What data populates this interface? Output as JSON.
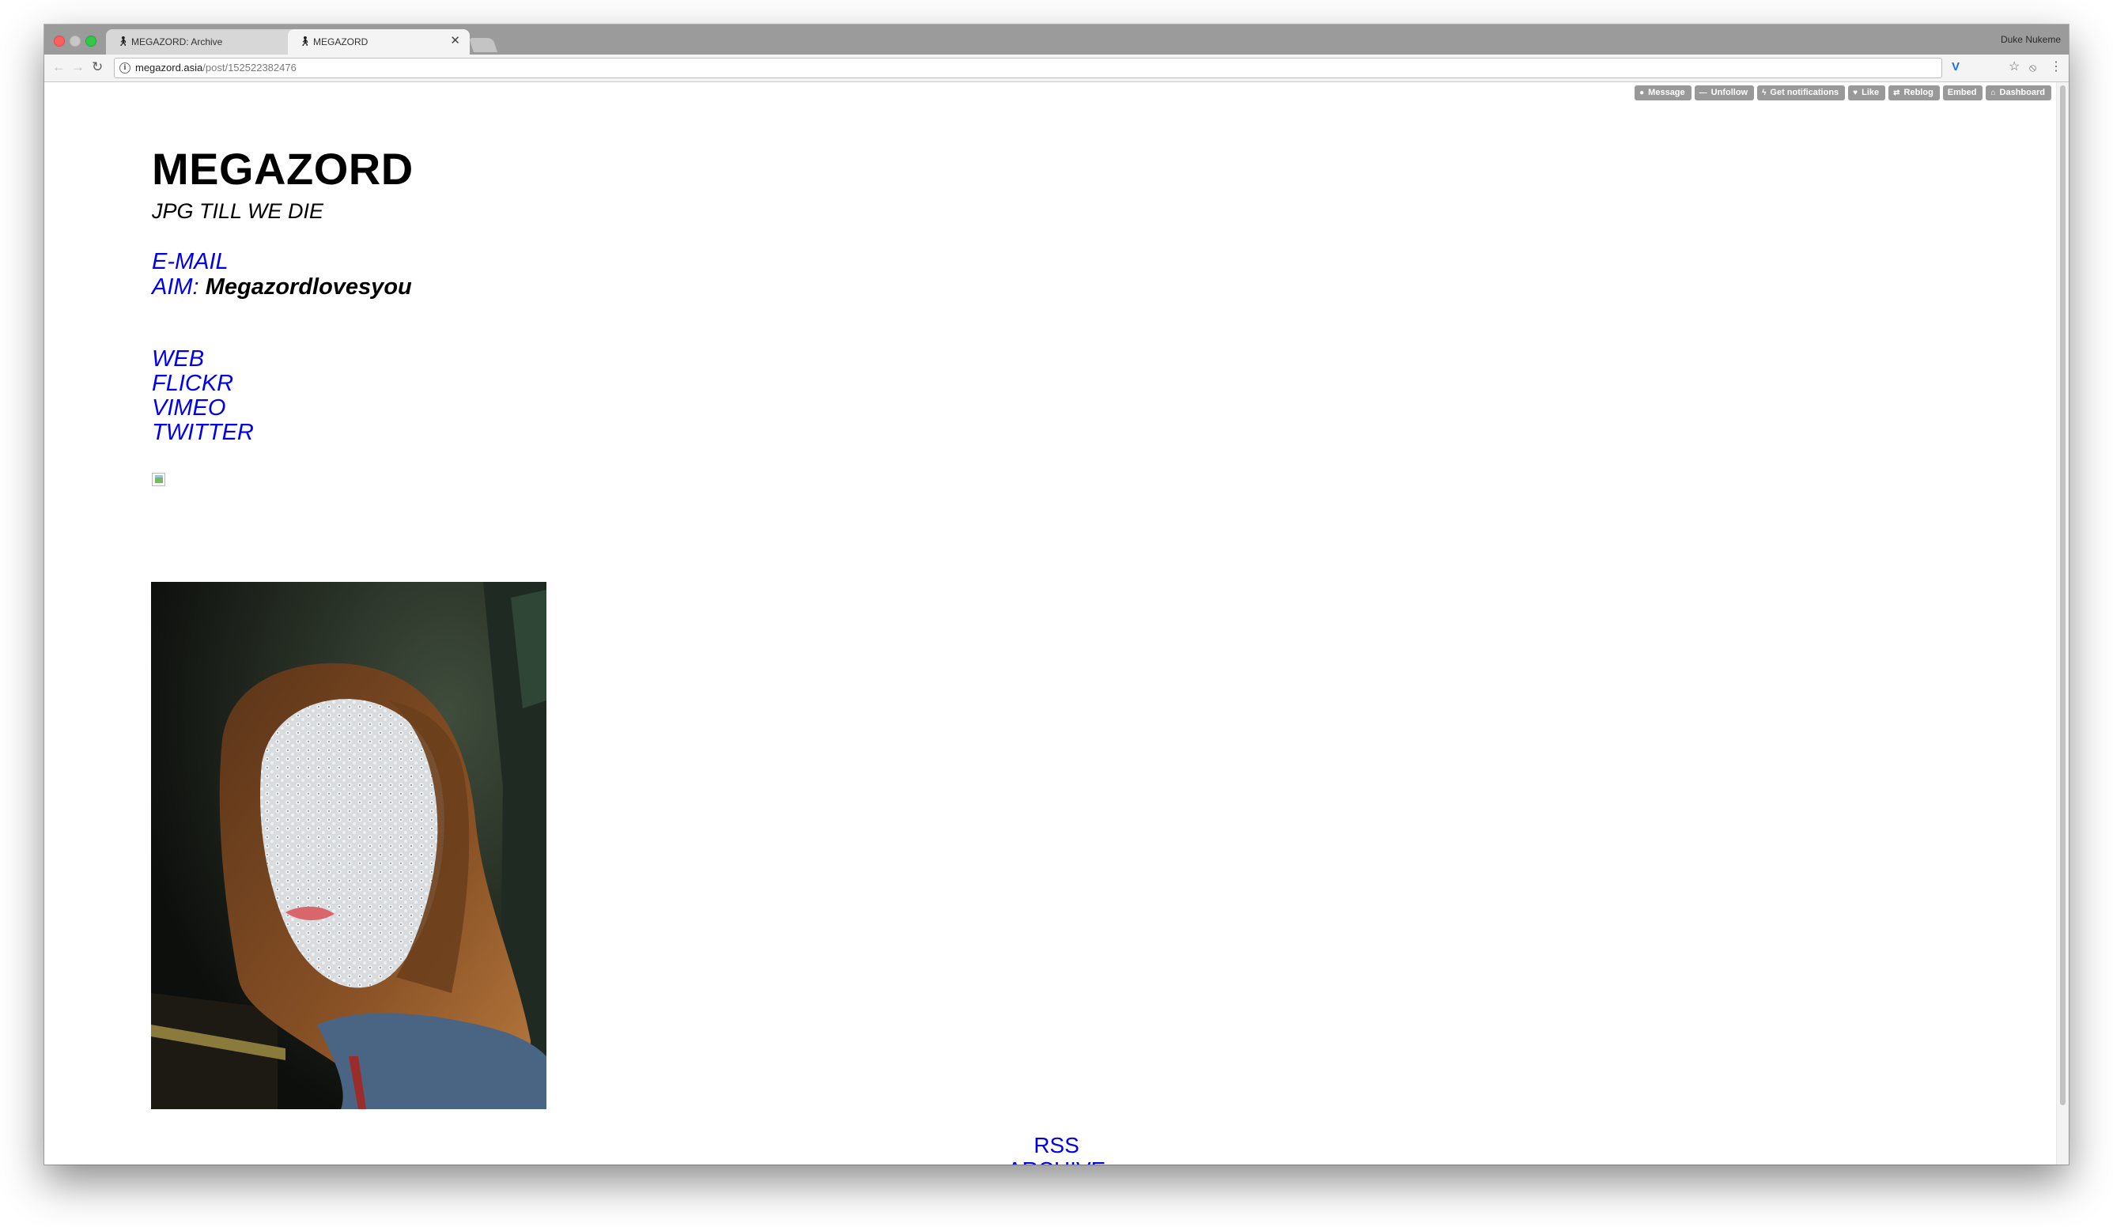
{
  "browser": {
    "tabs": [
      {
        "title": "MEGAZORD: Archive",
        "active": false
      },
      {
        "title": "MEGAZORD",
        "active": true
      }
    ],
    "profile_name": "Duke Nukeme",
    "url_host": "megazord.asia",
    "url_path": "/post/152522382476",
    "icons": {
      "back": "arrow-left-icon",
      "forward": "arrow-right-icon",
      "reload": "reload-icon",
      "info": "info-icon",
      "extension": "v-extension-icon",
      "bookmark": "star-icon",
      "extension2": "block-icon",
      "menu": "kebab-menu-icon"
    }
  },
  "tumblr_controls": [
    {
      "label": "Message",
      "icon": "speech-bubble-icon"
    },
    {
      "label": "Unfollow",
      "icon": "minus-icon"
    },
    {
      "label": "Get notifications",
      "icon": "lightning-icon"
    },
    {
      "label": "Like",
      "icon": "heart-icon"
    },
    {
      "label": "Reblog",
      "icon": "reblog-icon"
    },
    {
      "label": "Embed",
      "icon": ""
    },
    {
      "label": "Dashboard",
      "icon": "house-icon"
    }
  ],
  "blog": {
    "title": "MEGAZORD",
    "description": "JPG TILL WE DIE",
    "email_label": "E-MAIL",
    "aim_label": "AIM:",
    "aim_handle": "Megazordlovesyou",
    "links": [
      "WEB",
      "FLICKR",
      "VIMEO",
      "TWITTER"
    ]
  },
  "post": {
    "photo_subject": "portrait of a person with long auburn hair and white face mask covered in rhinestones, denim jacket"
  },
  "footer": {
    "rss": "RSS",
    "archive": "ARCHIVE"
  },
  "colors": {
    "link": "#0000ee",
    "text": "#000000",
    "control_bg": "#999999"
  }
}
